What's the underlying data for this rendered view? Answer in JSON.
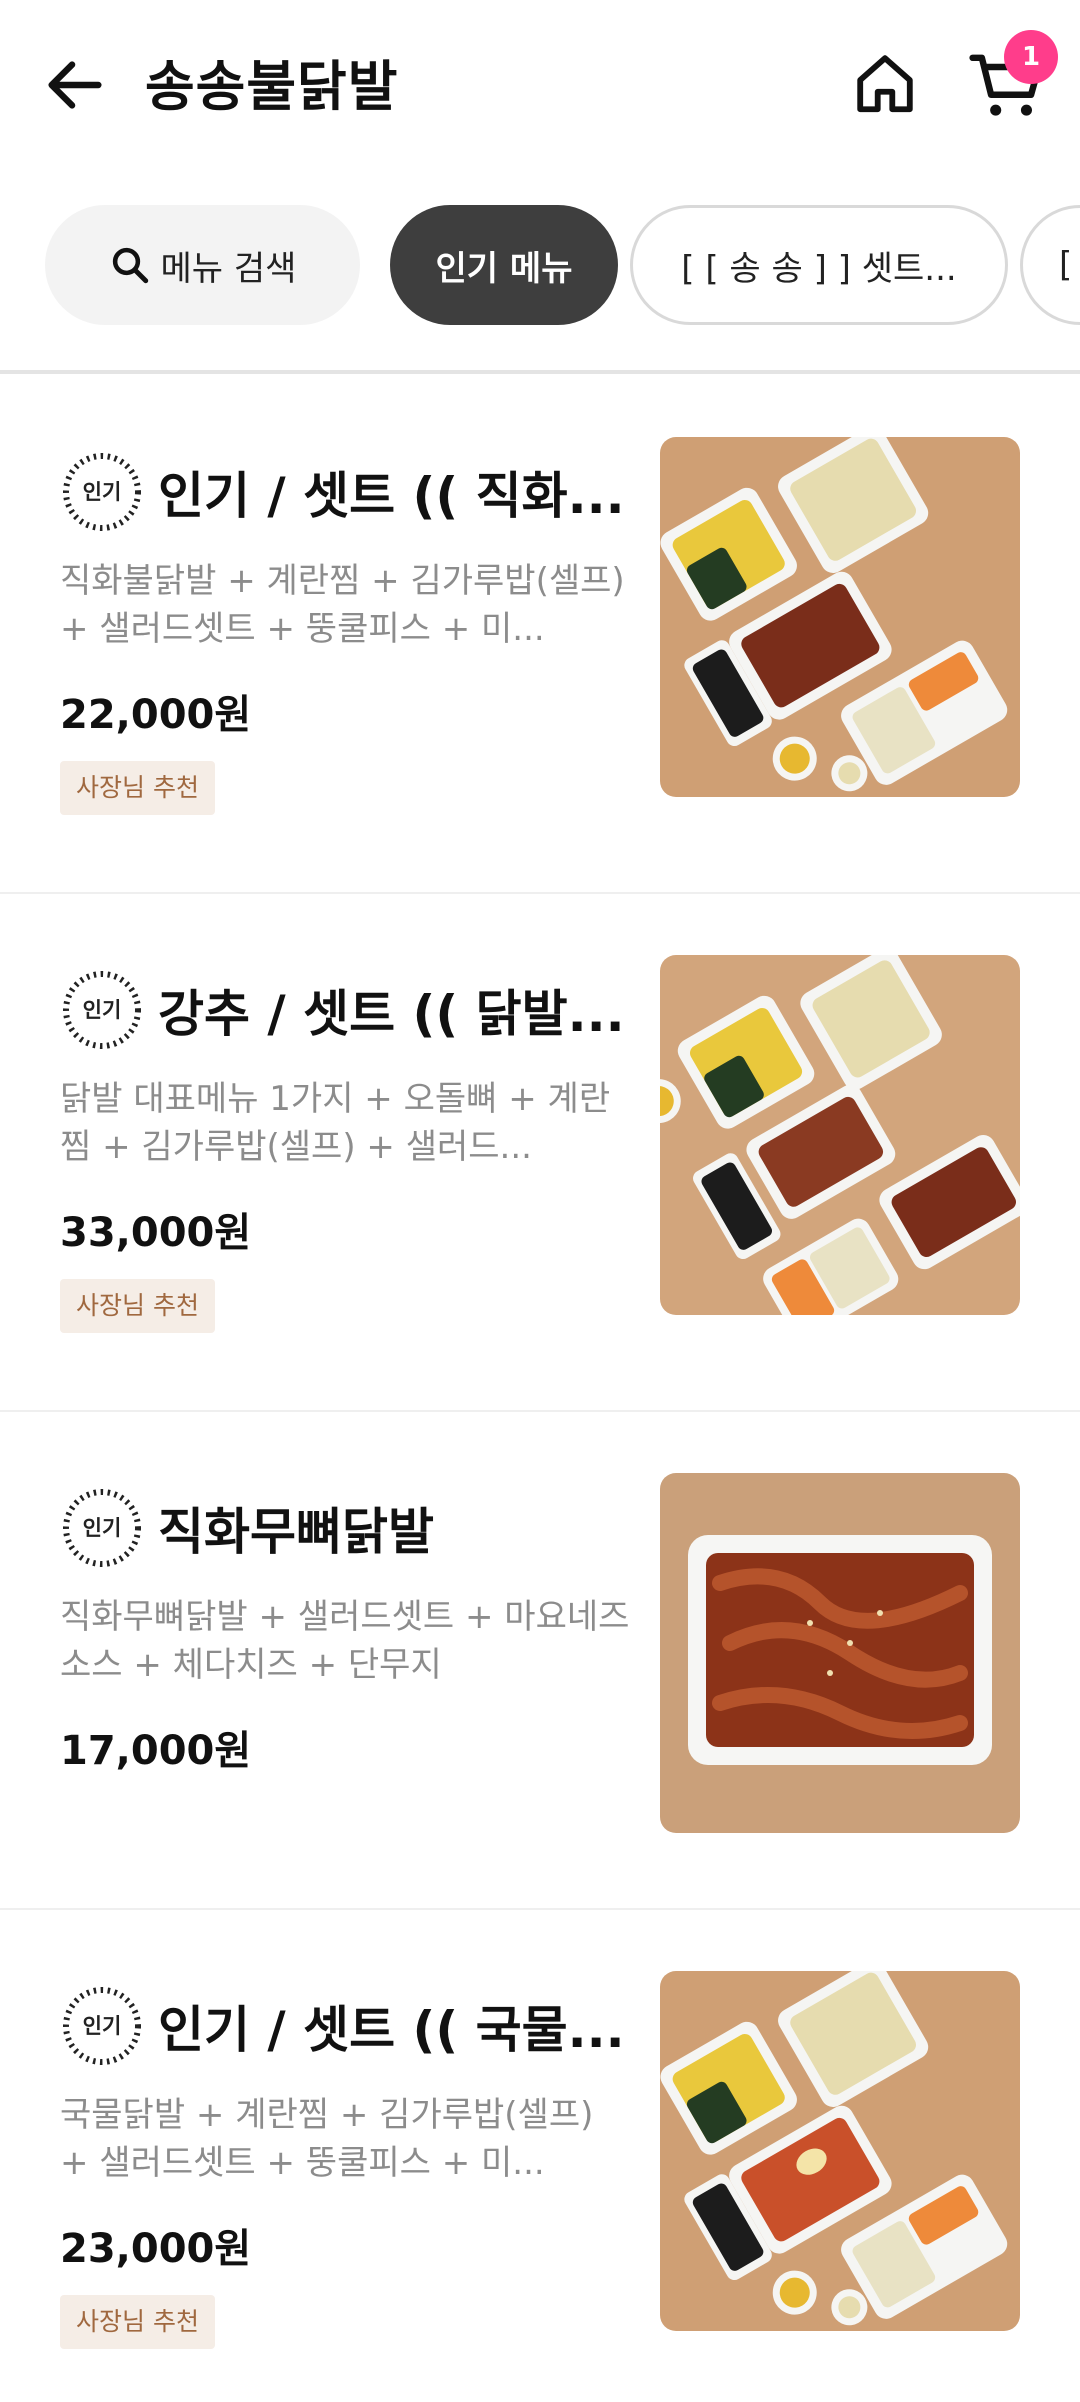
{
  "header": {
    "title": "송송불닭발",
    "cart_count": "1"
  },
  "chips": {
    "search_label": "메뉴 검색",
    "popular_label": "인기 메뉴",
    "set_label": "[ [ 송 송 ] ] 셋트...",
    "next_label": "["
  },
  "popular_badge_text": "인기",
  "menu": [
    {
      "name": "인기 / 셋트 (( 직화...",
      "description": "직화불닭발 + 계란찜 + 김가루밥(셀프) + 샐러드셋트 + 뚱쿨피스 + 미...",
      "price": "22,000원",
      "tag": "사장님 추천",
      "popular": true
    },
    {
      "name": "강추 / 셋트 (( 닭발...",
      "description": "닭발 대표메뉴 1가지 + 오돌뼈 + 계란찜 + 김가루밥(셀프) + 샐러드...",
      "price": "33,000원",
      "tag": "사장님 추천",
      "popular": true
    },
    {
      "name": "직화무뼈닭발",
      "description": "직화무뼈닭발 + 샐러드셋트 + 마요네즈소스 + 체다치즈 + 단무지",
      "price": "17,000원",
      "tag": "",
      "popular": true
    },
    {
      "name": "인기 / 셋트 (( 국물...",
      "description": "국물닭발 + 계란찜 + 김가루밥(셀프) + 샐러드셋트 + 뚱쿨피스 + 미...",
      "price": "23,000원",
      "tag": "사장님 추천",
      "popular": true
    }
  ],
  "colors": {
    "accent_badge": "#ff3d8b",
    "chip_active_bg": "#3e3e3e",
    "recommend_bg": "#f5ede6",
    "recommend_text": "#a0683f"
  }
}
